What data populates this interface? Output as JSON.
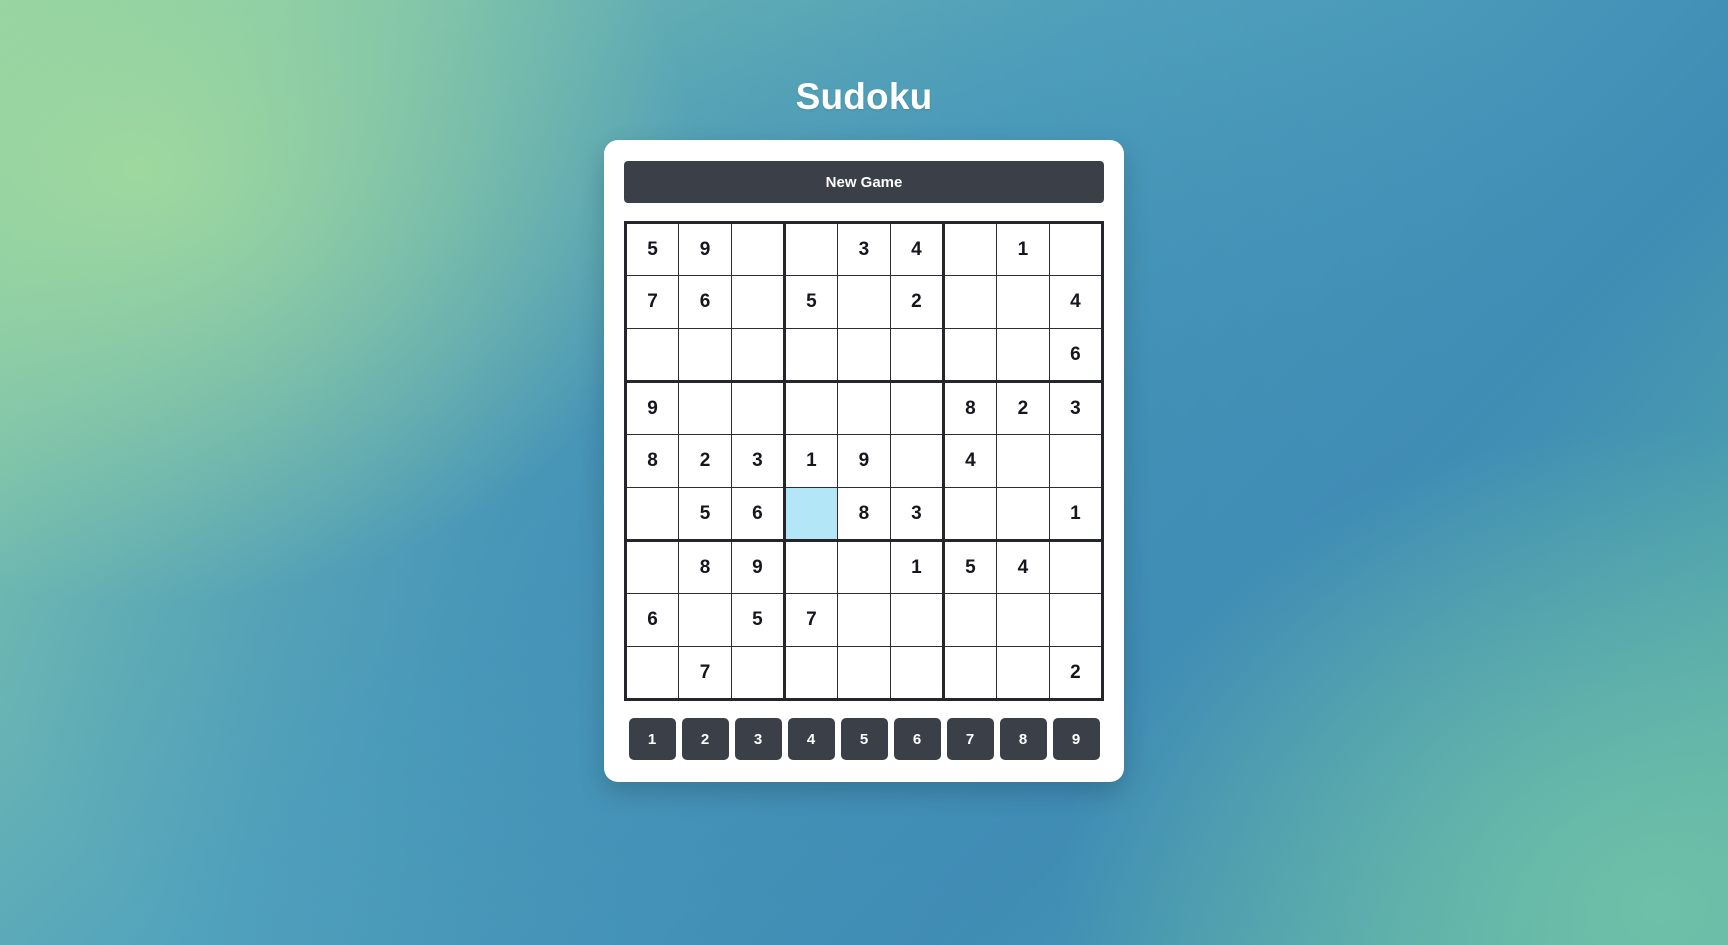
{
  "app": {
    "title": "Sudoku"
  },
  "toolbar": {
    "new_game_label": "New Game"
  },
  "colors": {
    "button_dark": "#3b3f48",
    "selected_cell": "#b3e6f7",
    "grid_line": "#2b2d33",
    "grid_border": "#24262b",
    "card_background": "#ffffff",
    "title_text": "#ffffff",
    "digit_text": "#15171c"
  },
  "board": {
    "rows": 9,
    "cols": 9,
    "selected_cell": {
      "row": 5,
      "col": 3
    },
    "cells": [
      [
        "5",
        "9",
        "",
        "",
        "3",
        "4",
        "",
        "1",
        ""
      ],
      [
        "7",
        "6",
        "",
        "5",
        "",
        "2",
        "",
        "",
        "4"
      ],
      [
        "",
        "",
        "",
        "",
        "",
        "",
        "",
        "",
        "6"
      ],
      [
        "9",
        "",
        "",
        "",
        "",
        "",
        "8",
        "2",
        "3"
      ],
      [
        "8",
        "2",
        "3",
        "1",
        "9",
        "",
        "4",
        "",
        ""
      ],
      [
        "",
        "5",
        "6",
        "",
        "8",
        "3",
        "",
        "",
        "1"
      ],
      [
        "",
        "8",
        "9",
        "",
        "",
        "1",
        "5",
        "4",
        ""
      ],
      [
        "6",
        "",
        "5",
        "7",
        "",
        "",
        "",
        "",
        ""
      ],
      [
        "",
        "7",
        "",
        "",
        "",
        "",
        "",
        "",
        "2"
      ]
    ]
  },
  "numpad": {
    "buttons": [
      "1",
      "2",
      "3",
      "4",
      "5",
      "6",
      "7",
      "8",
      "9"
    ]
  }
}
